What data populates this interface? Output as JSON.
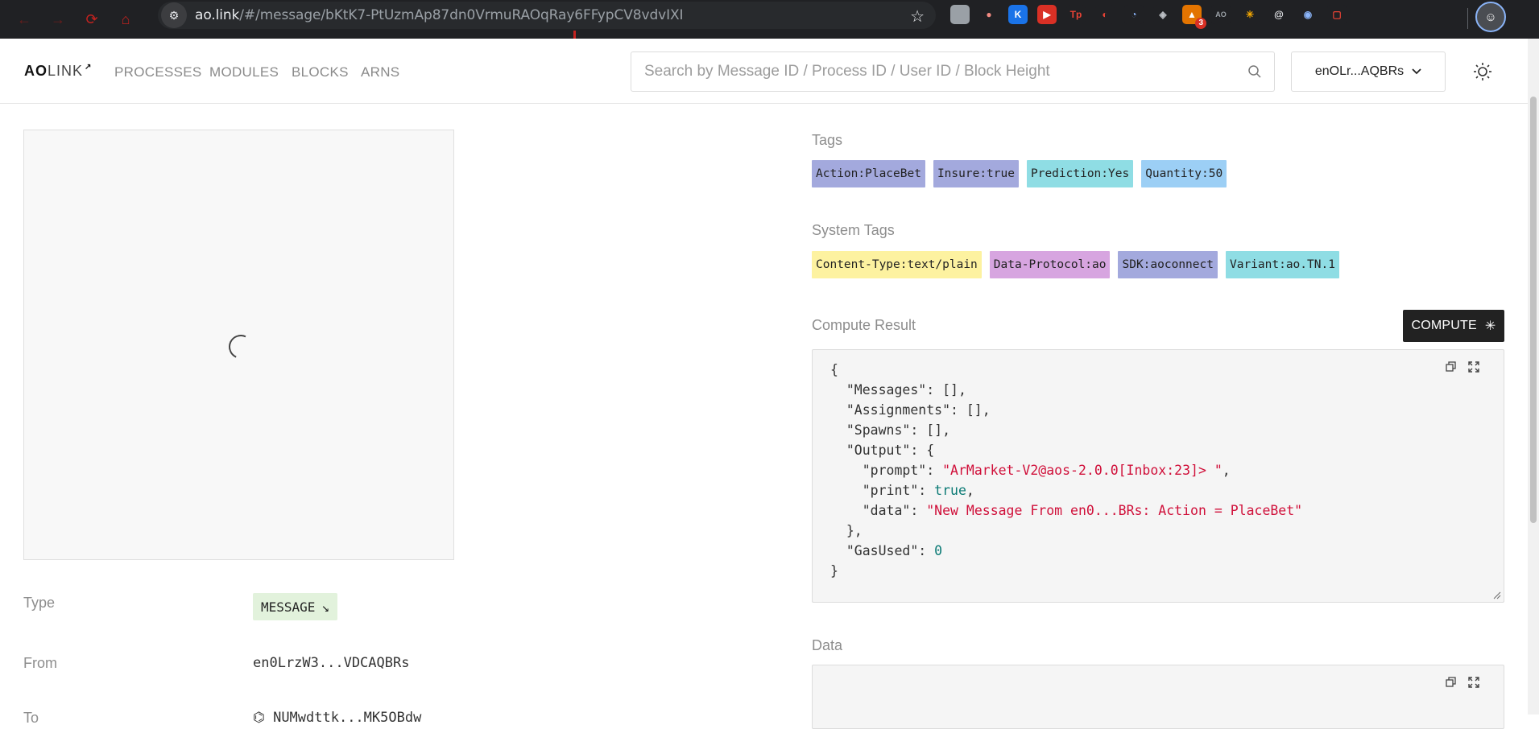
{
  "browser": {
    "url_host": "ao.link",
    "url_path": "/#/message/bKtK7-PtUzmAp87dn0VrmuRAOqRay6FFypCV8vdvIXI",
    "extension_badge": "3"
  },
  "header": {
    "logo_bold": "AO",
    "logo_light": "LINK",
    "nav": [
      "PROCESSES",
      "MODULES",
      "BLOCKS",
      "ARNS"
    ],
    "search_placeholder": "Search by Message ID / Process ID / User ID / Block Height",
    "wallet_label": "enOLr...AQBRs"
  },
  "details": {
    "type_label": "Type",
    "type_value": "MESSAGE",
    "from_label": "From",
    "from_value": "en0LrzW3...VDCAQBRs",
    "to_label": "To",
    "to_value": "NUMwdttk...MK5OBdw"
  },
  "tags": {
    "title": "Tags",
    "items": [
      {
        "text": "Action:PlaceBet",
        "color": "#a3a9dd"
      },
      {
        "text": "Insure:true",
        "color": "#a3a9dd"
      },
      {
        "text": "Prediction:Yes",
        "color": "#8fdde4"
      },
      {
        "text": "Quantity:50",
        "color": "#9ccff5"
      }
    ]
  },
  "system_tags": {
    "title": "System Tags",
    "items": [
      {
        "text": "Content-Type:text/plain",
        "color": "#fdf2a0"
      },
      {
        "text": "Data-Protocol:ao",
        "color": "#d7a5e0"
      },
      {
        "text": "SDK:aoconnect",
        "color": "#a3a9dd"
      },
      {
        "text": "Variant:ao.TN.1",
        "color": "#8fdde4"
      }
    ]
  },
  "compute": {
    "title": "Compute Result",
    "button_label": "COMPUTE",
    "lines": {
      "l1": "{",
      "l2": "  \"Messages\": [],",
      "l3": "  \"Assignments\": [],",
      "l4": "  \"Spawns\": [],",
      "l5": "  \"Output\": {",
      "l6_key": "    \"prompt\": ",
      "l6_val": "\"ArMarket-V2@aos-2.0.0[Inbox:23]> \"",
      "l6_end": ",",
      "l7_key": "    \"print\": ",
      "l7_val": "true",
      "l7_end": ",",
      "l8_key": "    \"data\": ",
      "l8_val": "\"New Message From en0...BRs: Action = PlaceBet\"",
      "l9": "  },",
      "l10_key": "  \"GasUsed\": ",
      "l10_val": "0",
      "l11": "}"
    }
  },
  "data_section": {
    "title": "Data"
  }
}
